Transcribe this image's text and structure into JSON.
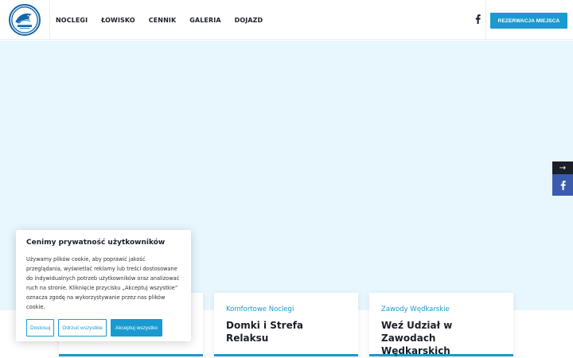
{
  "header": {
    "logo_icon": "fish-logo-icon",
    "nav": [
      {
        "label": "NOCLEGI"
      },
      {
        "label": "ŁOWISKO"
      },
      {
        "label": "CENNIK"
      },
      {
        "label": "GALERIA"
      },
      {
        "label": "DOJAZD"
      }
    ],
    "facebook_icon": "facebook-icon",
    "reserve_label": "REZERWACJA MIEJSCA"
  },
  "side": {
    "arrow": "→",
    "facebook_icon": "facebook-icon"
  },
  "cards": [
    {
      "kicker": "",
      "title": ""
    },
    {
      "kicker": "Komfortowe Noclegi",
      "title": "Domki i Strefa Relaksu"
    },
    {
      "kicker": "Zawody Wędkarskie",
      "title": "Weź Udział w Zawodach Wędkarskich"
    }
  ],
  "cookie": {
    "title": "Cenimy prywatność użytkowników",
    "text": "Używamy plików cookie, aby poprawić jakość przeglądania, wyświetlać reklamy lub treści dostosowane do indywidualnych potrzeb użytkowników oraz analizować ruch na stronie. Kliknięcie przycisku „Akceptuj wszystkie” oznacza zgodę na wykorzystywanie przez nas plików cookie.",
    "customize_label": "Dostosuj",
    "reject_label": "Odrzuć wszystkie",
    "accept_label": "Akceptuj wszystko"
  },
  "colors": {
    "accent": "#1a9ad0",
    "dark": "#1b1f2a",
    "facebook": "#3b5bae",
    "hero_bg": "#e8f6fd"
  }
}
